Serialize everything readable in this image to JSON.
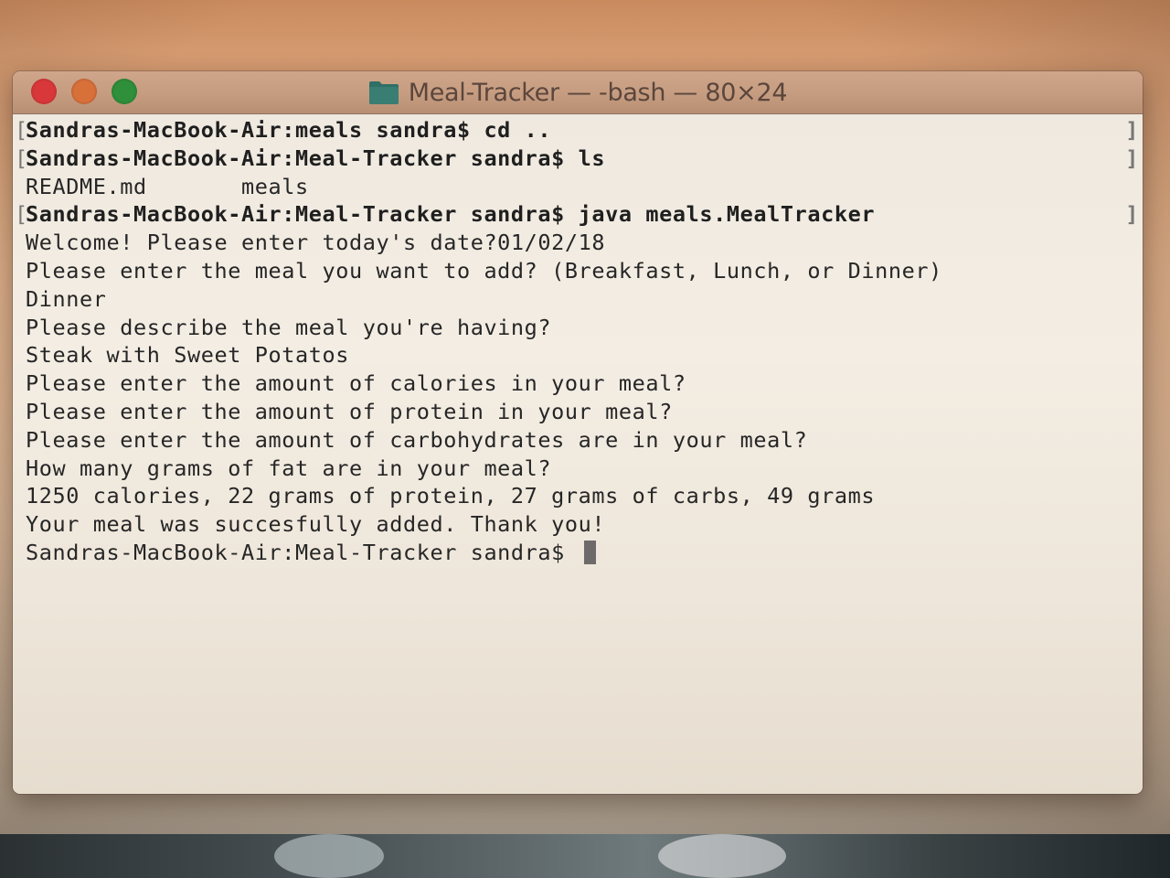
{
  "window": {
    "title": "Meal-Tracker — -bash — 80×24",
    "folder_icon": "folder-icon"
  },
  "terminal": {
    "lines": [
      {
        "text": "Sandras-MacBook-Air:meals sandra$ cd ..",
        "marked": true
      },
      {
        "text": "Sandras-MacBook-Air:Meal-Tracker sandra$ ls",
        "marked": true
      },
      {
        "text": "README.md       meals",
        "marked": false
      },
      {
        "text": "Sandras-MacBook-Air:Meal-Tracker sandra$ java meals.MealTracker",
        "marked": true
      },
      {
        "text": "Welcome! Please enter today's date?01/02/18",
        "marked": false
      },
      {
        "text": "Please enter the meal you want to add? (Breakfast, Lunch, or Dinner)",
        "marked": false
      },
      {
        "text": "Dinner",
        "marked": false
      },
      {
        "text": "Please describe the meal you're having?",
        "marked": false
      },
      {
        "text": "Steak with Sweet Potatos",
        "marked": false
      },
      {
        "text": "Please enter the amount of calories in your meal?",
        "marked": false
      },
      {
        "text": "Please enter the amount of protein in your meal?",
        "marked": false
      },
      {
        "text": "Please enter the amount of carbohydrates are in your meal?",
        "marked": false
      },
      {
        "text": "How many grams of fat are in your meal?",
        "marked": false
      },
      {
        "text": "1250 calories, 22 grams of protein, 27 grams of carbs, 49 grams",
        "marked": false
      },
      {
        "text": "Your meal was succesfully added. Thank you!",
        "marked": false
      }
    ],
    "prompt": "Sandras-MacBook-Air:Meal-Tracker sandra$ "
  },
  "colors": {
    "close": "#d9383a",
    "minimize": "#d8703a",
    "zoom": "#2f8f3a",
    "folder": "#2f6f66"
  }
}
